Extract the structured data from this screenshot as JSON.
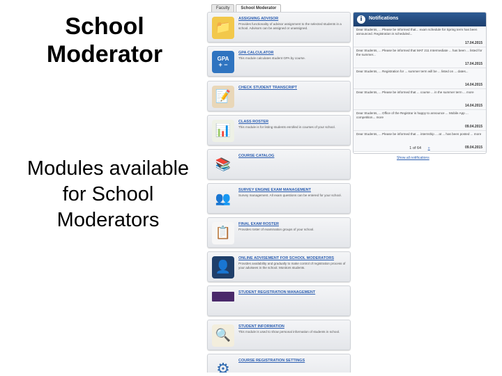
{
  "slide": {
    "title": "School Moderator",
    "subtitle": "Modules available for School Moderators"
  },
  "tabs": [
    {
      "label": "Faculty",
      "active": false
    },
    {
      "label": "School Moderator",
      "active": true
    }
  ],
  "modules": [
    {
      "title": "ASSIGNING ADVISOR",
      "desc": "Provides functionality of advisor assignment to the selected students in a school. Advisors can be assigned or unassigned.",
      "icon": "folder-person-icon"
    },
    {
      "title": "GPA CALCULATOR",
      "desc": "This module calculates student GPA by course.",
      "icon": "gpa-calculator-icon"
    },
    {
      "title": "CHECK STUDENT TRANSCRIPT",
      "desc": "",
      "icon": "transcript-icon"
    },
    {
      "title": "CLASS ROSTER",
      "desc": "This module is for listing students enrolled in courses of your school.",
      "icon": "class-roster-icon"
    },
    {
      "title": "COURSE CATALOG",
      "desc": "",
      "icon": "books-icon"
    },
    {
      "title": "SURVEY ENGINE EXAM MANAGEMENT",
      "desc": "Survey management. All exam questions can be entered for your school.",
      "icon": "people-icon"
    },
    {
      "title": "FINAL EXAM ROSTER",
      "desc": "Provides roster of examination groups of your school.",
      "icon": "exam-roster-icon"
    },
    {
      "title": "ONLINE ADVISEMENT FOR SCHOOL MODERATORS",
      "desc": "Provides availability and gradually to make control of registration process of your advisees in the school. Monitors students.",
      "icon": "advisement-icon"
    },
    {
      "title": "STUDENT REGISTRATION MANAGEMENT",
      "desc": "",
      "icon": "registration-icon"
    },
    {
      "title": "STUDENT INFORMATION",
      "desc": "This module is used to show personal information of students in school.",
      "icon": "student-info-icon"
    },
    {
      "title": "COURSE REGISTRATION SETTINGS",
      "desc": "",
      "icon": "gear-icon"
    }
  ],
  "notifications": {
    "title": "Notifications",
    "items": [
      {
        "text": "Dear Students, ... Please be informed that... exam schedule for Spring term has been announced. Registration is scheduled...",
        "date": "17.04.2015"
      },
      {
        "text": "Dear Students, ... Please be informed that MAT 211 Intermediate ... has been ... listed for the summer...",
        "date": "17.04.2015"
      },
      {
        "text": "Dear Students, ... Registration for ... summer term will be ... listed on ... dates...",
        "date": "14.04.2015"
      },
      {
        "text": "Dear Students, ... Please be informed that ... course ... in the summer term ... more",
        "date": "14.04.2015"
      },
      {
        "text": "Dear Students, ... Office of the Registrar is happy to announce ... Mobile App ... competition... more",
        "date": "09.04.2015"
      },
      {
        "text": "Dear Students, ... Please be informed that ... internship ... at ... has been posted ... more",
        "date": "09.04.2015"
      }
    ],
    "pager": "1 of 64",
    "pager_next": "»",
    "all_link": "Show all notifications"
  },
  "colors": {
    "accent": "#2a5db0",
    "header": "#1d3f6e"
  }
}
